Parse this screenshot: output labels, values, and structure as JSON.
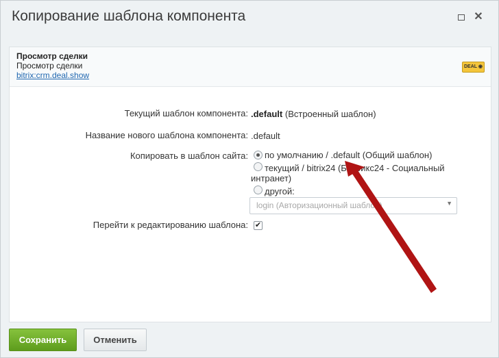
{
  "window": {
    "title": "Копирование шаблона компонента",
    "close_glyph": "✕"
  },
  "component": {
    "name": "Просмотр сделки",
    "description": "Просмотр сделки",
    "code": "bitrix:crm.deal.show",
    "badge": "DEAL ◉"
  },
  "form": {
    "current_template_label": "Текущий шаблон компонента:",
    "current_template_value": ".default",
    "current_template_note": "(Встроенный шаблон)",
    "new_name_label": "Название нового шаблона компонента:",
    "new_name_value": ".default",
    "copy_to_label": "Копировать в шаблон сайта:",
    "options": [
      {
        "label": "по умолчанию / .default (Общий шаблон)",
        "checked": true
      },
      {
        "label_line1": "текущий / bitrix24 (Битрикс24 - Социальный",
        "label_line2": "интранет)",
        "checked": false
      },
      {
        "label": "другой:",
        "checked": false
      }
    ],
    "select_value": "login (Авторизационный шаблон)",
    "select_arrow": "▼",
    "edit_label": "Перейти к редактированию шаблона:",
    "edit_checked": true,
    "check_glyph": "✔"
  },
  "footer": {
    "save_label": "Сохранить",
    "cancel_label": "Отменить"
  },
  "colors": {
    "accent_green": "#6aab25",
    "annotation_arrow": "#b01414"
  }
}
